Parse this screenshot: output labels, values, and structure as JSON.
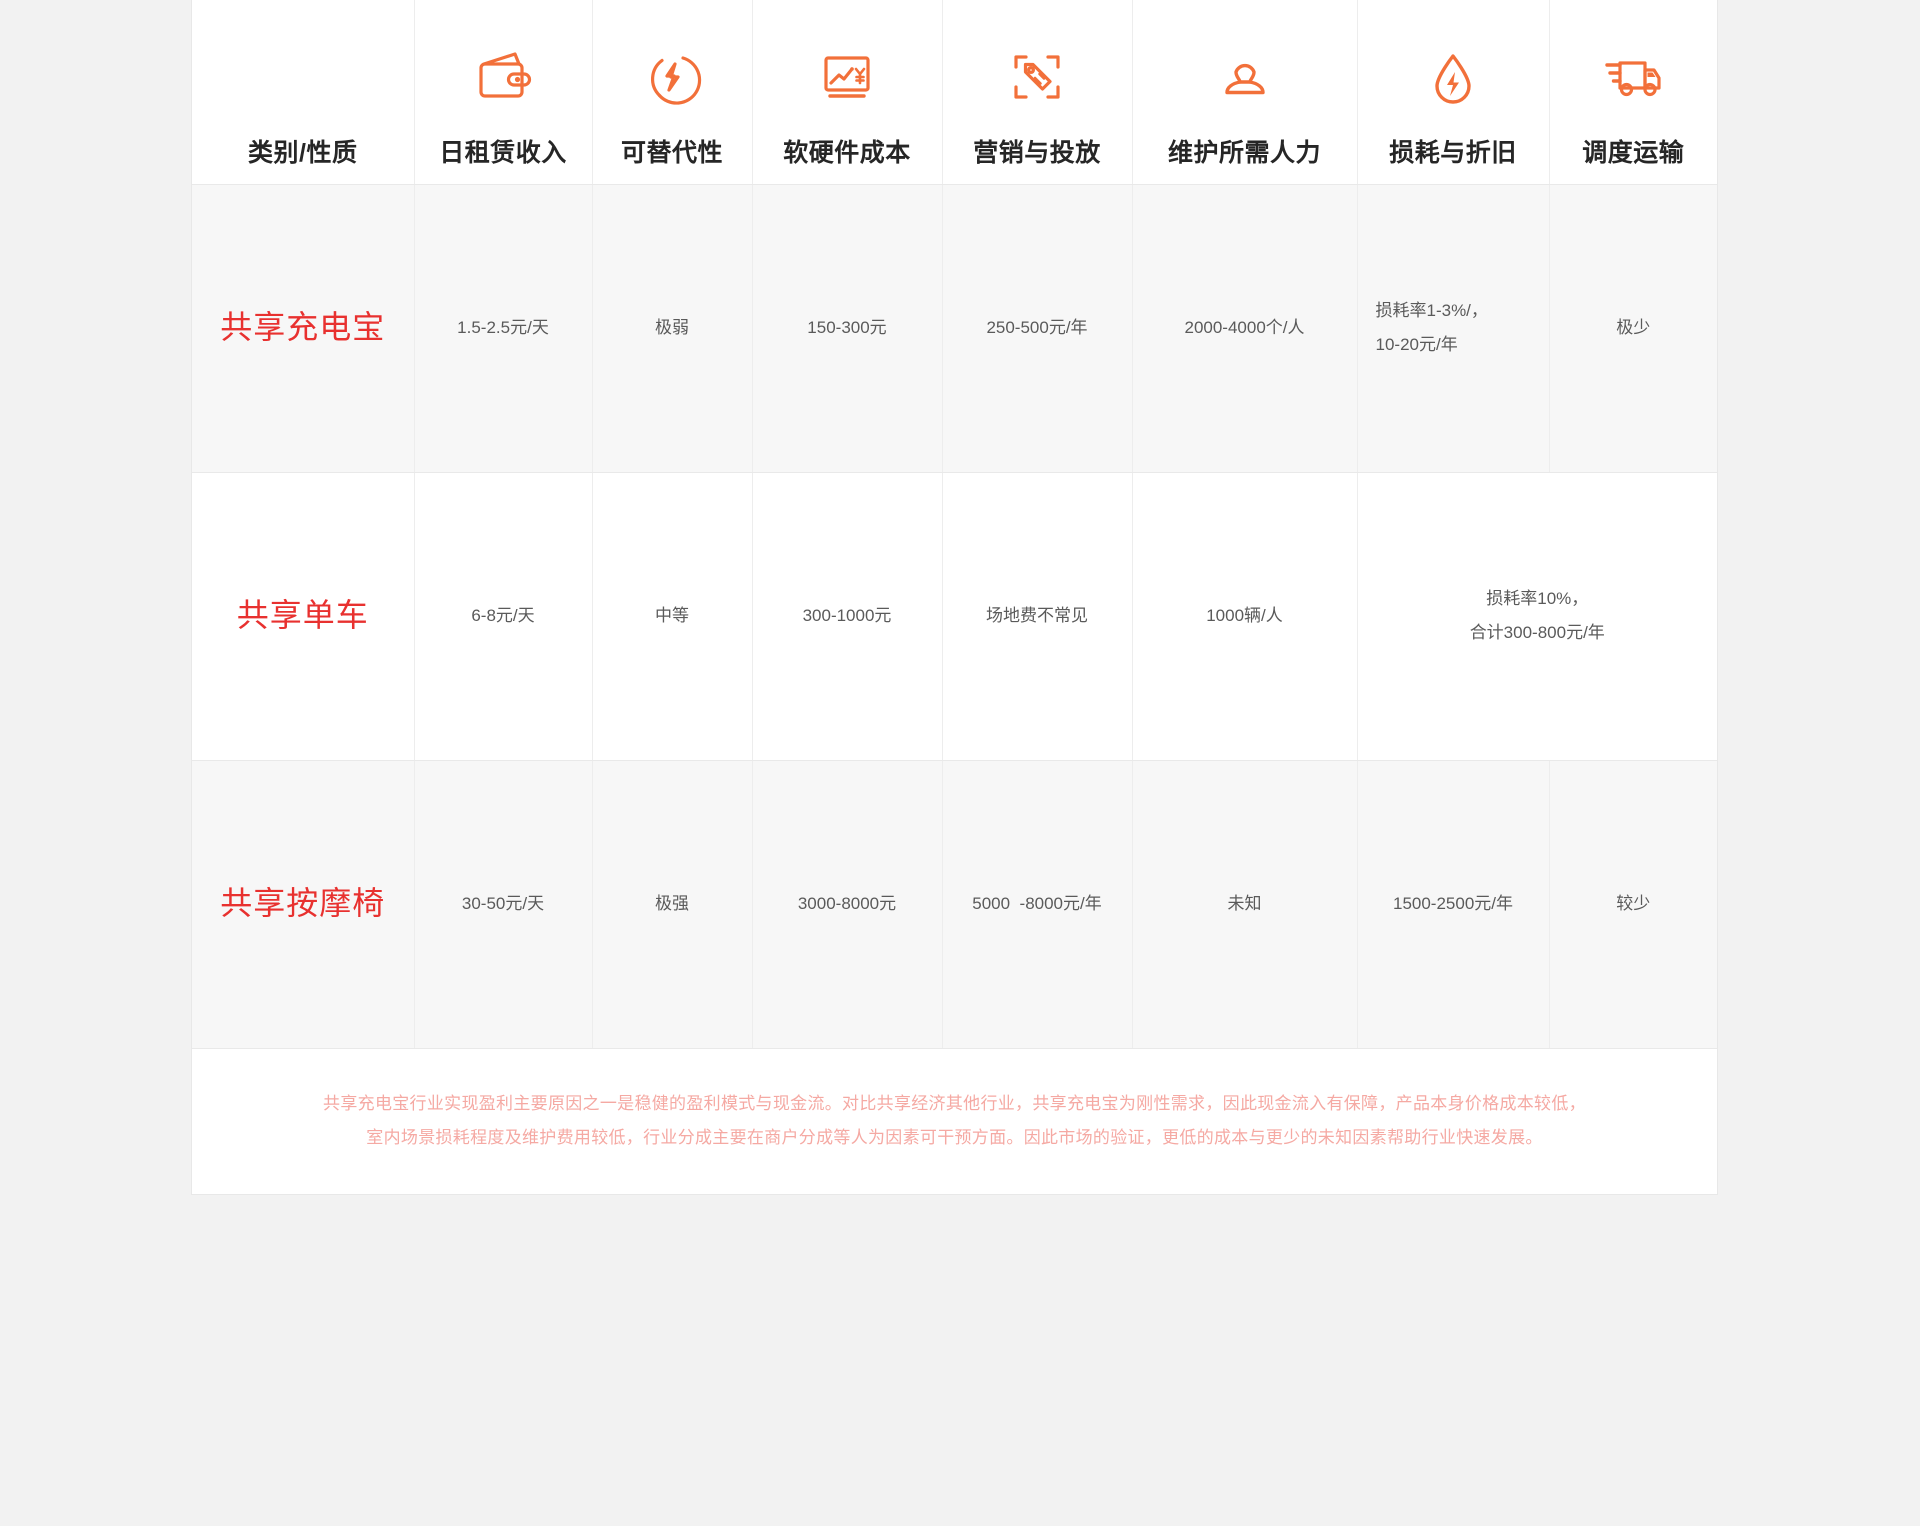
{
  "table": {
    "columns": [
      {
        "label": "类别/性质",
        "icon": "none"
      },
      {
        "label": "日租赁收入",
        "icon": "wallet-icon"
      },
      {
        "label": "可替代性",
        "icon": "lightning-circle-icon"
      },
      {
        "label": "软硬件成本",
        "icon": "monitor-chart-yen-icon"
      },
      {
        "label": "营销与投放",
        "icon": "price-tag-scan-icon"
      },
      {
        "label": "维护所需人力",
        "icon": "person-icon"
      },
      {
        "label": "损耗与折旧",
        "icon": "droplet-lightning-icon"
      },
      {
        "label": "调度运输",
        "icon": "delivery-truck-icon"
      }
    ],
    "rows": [
      {
        "category": "共享充电宝",
        "daily_income": "1.5-2.5元/天",
        "substitutability": "极弱",
        "hardware_cost": "150-300元",
        "marketing": "250-500元/年",
        "maintenance_labor": "2000-4000个/人",
        "depreciation": "损耗率1-3%/，\n10-20元/年",
        "logistics": "极少"
      },
      {
        "category": "共享单车",
        "daily_income": "6-8元/天",
        "substitutability": "中等",
        "hardware_cost": "300-1000元",
        "marketing": "场地费不常见",
        "maintenance_labor": "1000辆/人",
        "depreciation_merged": "损耗率10%，\n合计300-800元/年"
      },
      {
        "category": "共享按摩椅",
        "daily_income": "30-50元/天",
        "substitutability": "极强",
        "hardware_cost": "3000-8000元",
        "marketing": "5000  -8000元/年",
        "maintenance_labor": "未知",
        "depreciation": "1500-2500元/年",
        "logistics": "较少"
      }
    ],
    "note": {
      "line1": "共享充电宝行业实现盈利主要原因之一是稳健的盈利模式与现金流。对比共享经济其他行业，共享充电宝为刚性需求，因此现金流入有保障，产品本身价格成本较低，",
      "line2": "室内场景损耗程度及维护费用较低，行业分成主要在商户分成等人为因素可干预方面。因此市场的验证，更低的成本与更少的未知因素帮助行业快速发展。"
    },
    "colors": {
      "accent": "#f2703a",
      "category_red": "#e8312f",
      "note_pink": "#f5a9a3",
      "row_shade": "#f7f7f7",
      "page_bg": "#f2f2f2"
    }
  }
}
